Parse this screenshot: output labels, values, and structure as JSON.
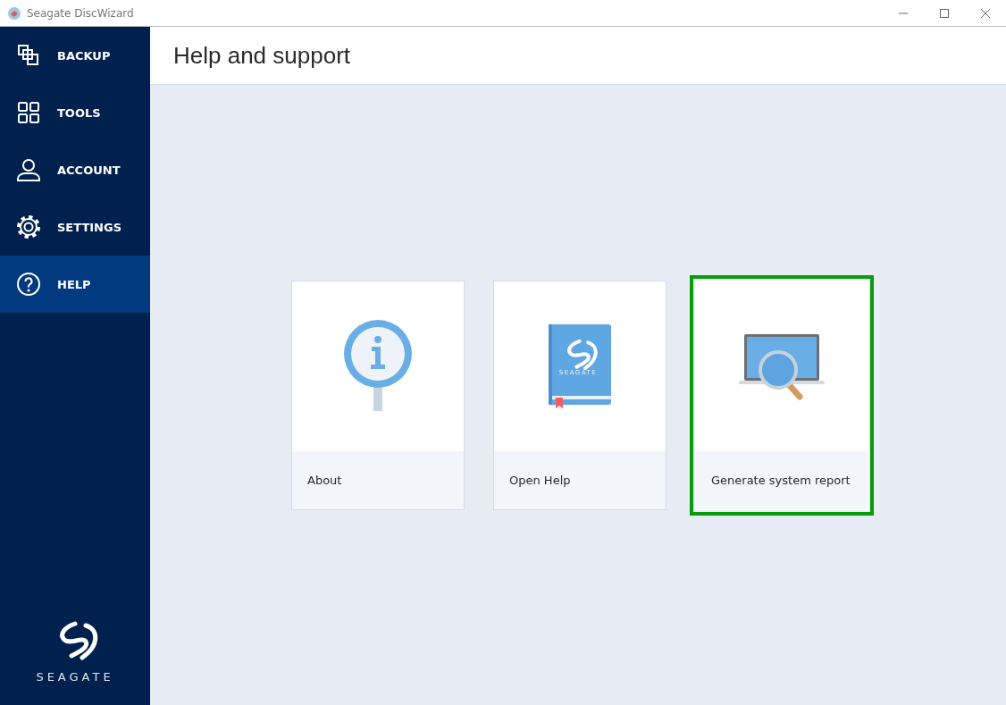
{
  "window": {
    "title": "Seagate DiscWizard"
  },
  "sidebar": {
    "items": [
      {
        "label": "BACKUP",
        "kind": "backup",
        "selected": false
      },
      {
        "label": "TOOLS",
        "kind": "tools",
        "selected": false
      },
      {
        "label": "ACCOUNT",
        "kind": "account",
        "selected": false
      },
      {
        "label": "SETTINGS",
        "kind": "settings",
        "selected": false
      },
      {
        "label": "HELP",
        "kind": "help",
        "selected": true
      }
    ],
    "logo_text": "SEAGATE"
  },
  "page": {
    "title": "Help and support"
  },
  "cards": [
    {
      "label": "About",
      "kind": "info",
      "selected": false
    },
    {
      "label": "Open Help",
      "kind": "book",
      "book_label": "SEAGATE",
      "selected": false
    },
    {
      "label": "Generate system report",
      "kind": "report",
      "selected": true
    }
  ]
}
